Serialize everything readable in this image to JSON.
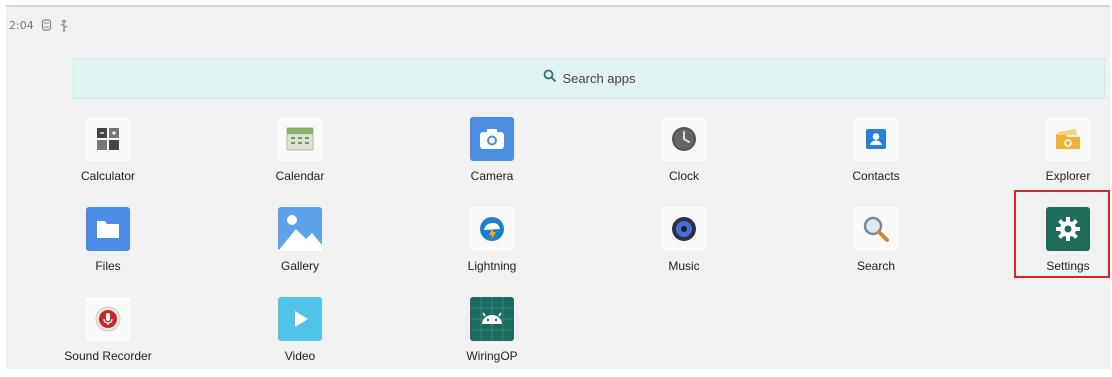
{
  "status_bar": {
    "time": "2:04",
    "icons": [
      "sync-icon",
      "usb-icon"
    ]
  },
  "search": {
    "label": "Search apps",
    "icon": "search-icon"
  },
  "apps": [
    {
      "name": "calculator",
      "label": "Calculator",
      "icon": "calculator-icon"
    },
    {
      "name": "calendar",
      "label": "Calendar",
      "icon": "calendar-icon"
    },
    {
      "name": "camera",
      "label": "Camera",
      "icon": "camera-icon"
    },
    {
      "name": "clock",
      "label": "Clock",
      "icon": "clock-icon"
    },
    {
      "name": "contacts",
      "label": "Contacts",
      "icon": "contacts-icon"
    },
    {
      "name": "explorer",
      "label": "Explorer",
      "icon": "explorer-icon"
    },
    {
      "name": "files",
      "label": "Files",
      "icon": "folder-icon"
    },
    {
      "name": "gallery",
      "label": "Gallery",
      "icon": "gallery-icon"
    },
    {
      "name": "lightning",
      "label": "Lightning",
      "icon": "lightning-icon"
    },
    {
      "name": "music",
      "label": "Music",
      "icon": "music-icon"
    },
    {
      "name": "search",
      "label": "Search",
      "icon": "magnifier-icon"
    },
    {
      "name": "settings",
      "label": "Settings",
      "icon": "gear-icon"
    },
    {
      "name": "sound-recorder",
      "label": "Sound Recorder",
      "icon": "microphone-icon"
    },
    {
      "name": "video",
      "label": "Video",
      "icon": "play-icon"
    },
    {
      "name": "wiringop",
      "label": "WiringOP",
      "icon": "android-icon"
    }
  ],
  "highlighted_app": "Settings",
  "colors": {
    "search_bg": "#dff3f2",
    "highlight": "#d7262a",
    "settings_tile": "#1f6b5a"
  }
}
